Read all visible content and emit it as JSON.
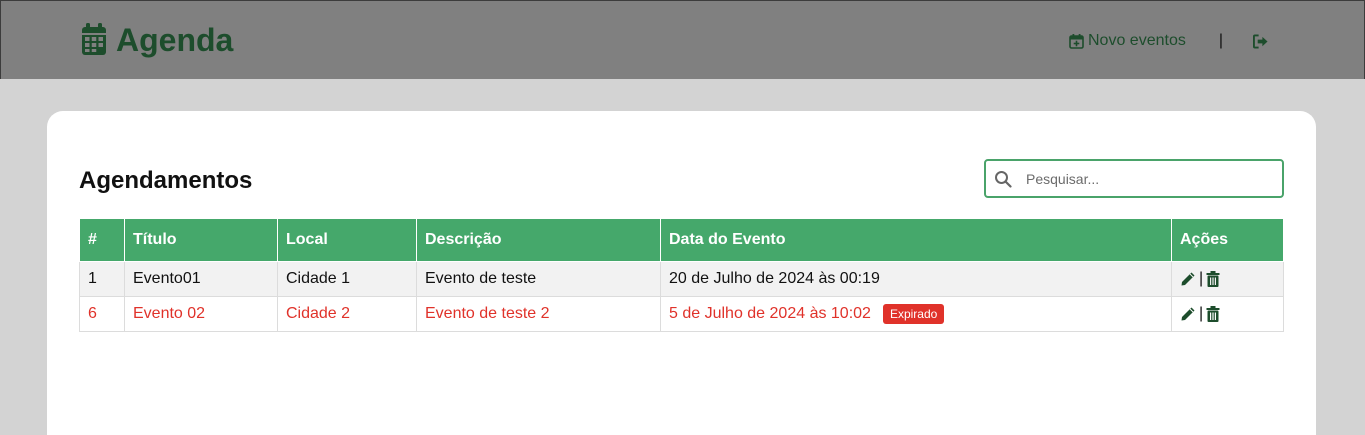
{
  "header": {
    "app_title": "Agenda",
    "new_event_label": "Novo eventos",
    "separator": "|"
  },
  "icons": {
    "brand": "calendar-icon",
    "new_event": "calendar-plus-icon",
    "logout": "sign-out-icon",
    "search": "search-icon",
    "edit": "pencil-icon",
    "delete": "trash-icon"
  },
  "colors": {
    "brand_green": "#1d4d2c",
    "header_bar": "#808080",
    "table_header": "#45a86b",
    "expired": "#e0322a"
  },
  "main": {
    "title": "Agendamentos",
    "search": {
      "placeholder": "Pesquisar...",
      "value": ""
    },
    "table": {
      "columns": [
        "#",
        "Título",
        "Local",
        "Descrição",
        "Data do Evento",
        "Ações"
      ],
      "rows": [
        {
          "id": "1",
          "titulo": "Evento01",
          "local": "Cidade 1",
          "descricao": "Evento de teste",
          "data": "20 de Julho de 2024 às 00:19",
          "badge": "",
          "action_sep": "|"
        },
        {
          "id": "6",
          "titulo": "Evento 02",
          "local": "Cidade 2",
          "descricao": "Evento de teste 2",
          "data": "5 de Julho de 2024 às 10:02",
          "badge": "Expirado",
          "action_sep": "|"
        }
      ]
    }
  }
}
